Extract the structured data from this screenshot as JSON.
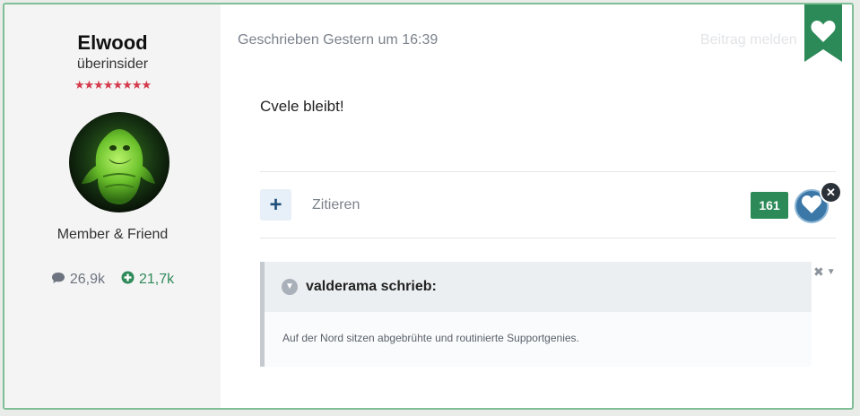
{
  "author": {
    "name": "Elwood",
    "title": "überinsider",
    "stars": "★★★★★★★★",
    "group": "Member & Friend",
    "posts": "26,9k",
    "reputation": "21,7k"
  },
  "post": {
    "meta": "Geschrieben Gestern um 16:39",
    "report_label": "Beitrag melden",
    "content": "Cvele bleibt!",
    "quote_label": "Zitieren",
    "reaction_count": "161"
  },
  "quote": {
    "author": "valderama schrieb:",
    "text": "Auf der Nord sitzen abgebrühte und routinierte Supportgenies."
  },
  "icons": {
    "ribbon": "heart-ribbon-icon",
    "reaction": "heart-icon",
    "close": "close-icon",
    "posts": "comment-icon",
    "reputation": "plus-circle-icon",
    "quote_toggle": "chevron-down-icon"
  },
  "colors": {
    "accent_green": "#2c8a58",
    "react_blue": "#3b78a8",
    "stars_red": "#d43a4c"
  }
}
